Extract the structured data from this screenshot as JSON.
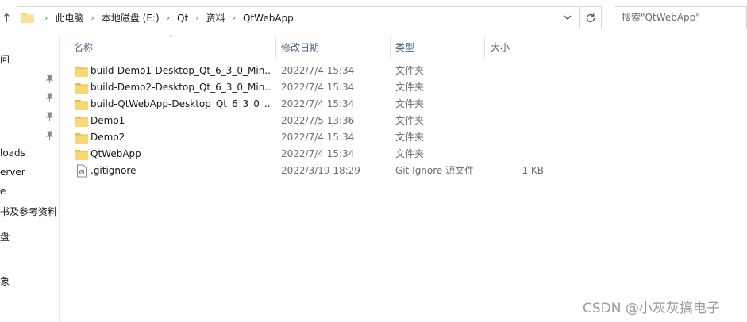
{
  "address": {
    "breadcrumbs": [
      "此电脑",
      "本地磁盘 (E:)",
      "Qt",
      "资料",
      "QtWebApp"
    ]
  },
  "search": {
    "placeholder": "搜索\"QtWebApp\""
  },
  "sidebar": {
    "items": [
      {
        "label": "问"
      },
      {
        "label": "loads"
      },
      {
        "label": "erver"
      },
      {
        "label": "e"
      },
      {
        "label": "书及参考资料"
      },
      {
        "label": "盘"
      },
      {
        "label": "象"
      }
    ]
  },
  "columns": {
    "name": "名称",
    "date": "修改日期",
    "type": "类型",
    "size": "大小"
  },
  "files": [
    {
      "name": "build-Demo1-Desktop_Qt_6_3_0_Min...",
      "date": "2022/7/4 15:34",
      "type": "文件夹",
      "size": "",
      "icon": "folder-icon"
    },
    {
      "name": "build-Demo2-Desktop_Qt_6_3_0_Min...",
      "date": "2022/7/4 15:34",
      "type": "文件夹",
      "size": "",
      "icon": "folder-icon"
    },
    {
      "name": "build-QtWebApp-Desktop_Qt_6_3_0_...",
      "date": "2022/7/4 15:34",
      "type": "文件夹",
      "size": "",
      "icon": "folder-icon"
    },
    {
      "name": "Demo1",
      "date": "2022/7/5 13:36",
      "type": "文件夹",
      "size": "",
      "icon": "folder-icon"
    },
    {
      "name": "Demo2",
      "date": "2022/7/4 15:34",
      "type": "文件夹",
      "size": "",
      "icon": "folder-icon"
    },
    {
      "name": "QtWebApp",
      "date": "2022/7/4 15:34",
      "type": "文件夹",
      "size": "",
      "icon": "folder-icon"
    },
    {
      "name": ".gitignore",
      "date": "2022/3/19 18:29",
      "type": "Git Ignore 源文件",
      "size": "1 KB",
      "icon": "file-icon"
    }
  ],
  "watermark": "CSDN @小灰灰搞电子",
  "colors": {
    "folder": "#f8d775",
    "header_text": "#4c607a"
  }
}
